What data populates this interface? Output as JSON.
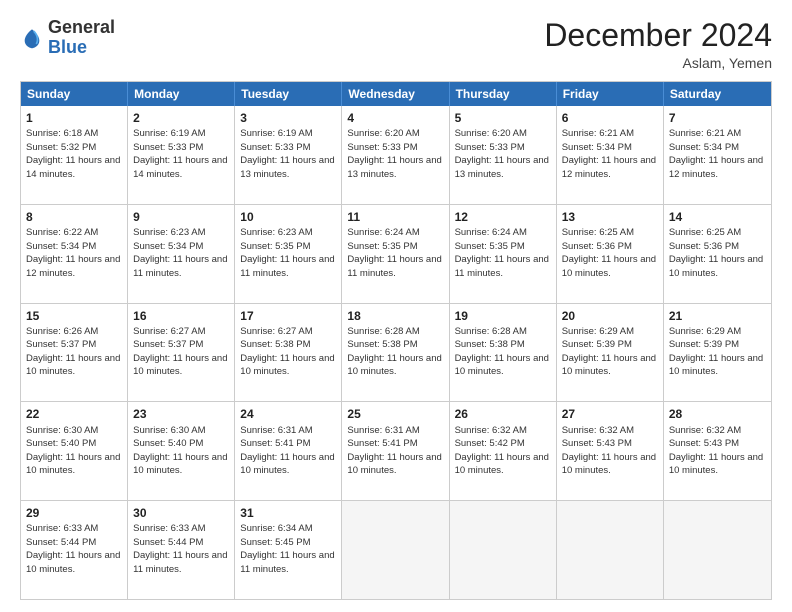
{
  "header": {
    "logo_general": "General",
    "logo_blue": "Blue",
    "month_title": "December 2024",
    "location": "Aslam, Yemen"
  },
  "weekdays": [
    "Sunday",
    "Monday",
    "Tuesday",
    "Wednesday",
    "Thursday",
    "Friday",
    "Saturday"
  ],
  "rows": [
    [
      {
        "day": "1",
        "sunrise": "6:18 AM",
        "sunset": "5:32 PM",
        "daylight": "11 hours and 14 minutes."
      },
      {
        "day": "2",
        "sunrise": "6:19 AM",
        "sunset": "5:33 PM",
        "daylight": "11 hours and 14 minutes."
      },
      {
        "day": "3",
        "sunrise": "6:19 AM",
        "sunset": "5:33 PM",
        "daylight": "11 hours and 13 minutes."
      },
      {
        "day": "4",
        "sunrise": "6:20 AM",
        "sunset": "5:33 PM",
        "daylight": "11 hours and 13 minutes."
      },
      {
        "day": "5",
        "sunrise": "6:20 AM",
        "sunset": "5:33 PM",
        "daylight": "11 hours and 13 minutes."
      },
      {
        "day": "6",
        "sunrise": "6:21 AM",
        "sunset": "5:34 PM",
        "daylight": "11 hours and 12 minutes."
      },
      {
        "day": "7",
        "sunrise": "6:21 AM",
        "sunset": "5:34 PM",
        "daylight": "11 hours and 12 minutes."
      }
    ],
    [
      {
        "day": "8",
        "sunrise": "6:22 AM",
        "sunset": "5:34 PM",
        "daylight": "11 hours and 12 minutes."
      },
      {
        "day": "9",
        "sunrise": "6:23 AM",
        "sunset": "5:34 PM",
        "daylight": "11 hours and 11 minutes."
      },
      {
        "day": "10",
        "sunrise": "6:23 AM",
        "sunset": "5:35 PM",
        "daylight": "11 hours and 11 minutes."
      },
      {
        "day": "11",
        "sunrise": "6:24 AM",
        "sunset": "5:35 PM",
        "daylight": "11 hours and 11 minutes."
      },
      {
        "day": "12",
        "sunrise": "6:24 AM",
        "sunset": "5:35 PM",
        "daylight": "11 hours and 11 minutes."
      },
      {
        "day": "13",
        "sunrise": "6:25 AM",
        "sunset": "5:36 PM",
        "daylight": "11 hours and 10 minutes."
      },
      {
        "day": "14",
        "sunrise": "6:25 AM",
        "sunset": "5:36 PM",
        "daylight": "11 hours and 10 minutes."
      }
    ],
    [
      {
        "day": "15",
        "sunrise": "6:26 AM",
        "sunset": "5:37 PM",
        "daylight": "11 hours and 10 minutes."
      },
      {
        "day": "16",
        "sunrise": "6:27 AM",
        "sunset": "5:37 PM",
        "daylight": "11 hours and 10 minutes."
      },
      {
        "day": "17",
        "sunrise": "6:27 AM",
        "sunset": "5:38 PM",
        "daylight": "11 hours and 10 minutes."
      },
      {
        "day": "18",
        "sunrise": "6:28 AM",
        "sunset": "5:38 PM",
        "daylight": "11 hours and 10 minutes."
      },
      {
        "day": "19",
        "sunrise": "6:28 AM",
        "sunset": "5:38 PM",
        "daylight": "11 hours and 10 minutes."
      },
      {
        "day": "20",
        "sunrise": "6:29 AM",
        "sunset": "5:39 PM",
        "daylight": "11 hours and 10 minutes."
      },
      {
        "day": "21",
        "sunrise": "6:29 AM",
        "sunset": "5:39 PM",
        "daylight": "11 hours and 10 minutes."
      }
    ],
    [
      {
        "day": "22",
        "sunrise": "6:30 AM",
        "sunset": "5:40 PM",
        "daylight": "11 hours and 10 minutes."
      },
      {
        "day": "23",
        "sunrise": "6:30 AM",
        "sunset": "5:40 PM",
        "daylight": "11 hours and 10 minutes."
      },
      {
        "day": "24",
        "sunrise": "6:31 AM",
        "sunset": "5:41 PM",
        "daylight": "11 hours and 10 minutes."
      },
      {
        "day": "25",
        "sunrise": "6:31 AM",
        "sunset": "5:41 PM",
        "daylight": "11 hours and 10 minutes."
      },
      {
        "day": "26",
        "sunrise": "6:32 AM",
        "sunset": "5:42 PM",
        "daylight": "11 hours and 10 minutes."
      },
      {
        "day": "27",
        "sunrise": "6:32 AM",
        "sunset": "5:43 PM",
        "daylight": "11 hours and 10 minutes."
      },
      {
        "day": "28",
        "sunrise": "6:32 AM",
        "sunset": "5:43 PM",
        "daylight": "11 hours and 10 minutes."
      }
    ],
    [
      {
        "day": "29",
        "sunrise": "6:33 AM",
        "sunset": "5:44 PM",
        "daylight": "11 hours and 10 minutes."
      },
      {
        "day": "30",
        "sunrise": "6:33 AM",
        "sunset": "5:44 PM",
        "daylight": "11 hours and 11 minutes."
      },
      {
        "day": "31",
        "sunrise": "6:34 AM",
        "sunset": "5:45 PM",
        "daylight": "11 hours and 11 minutes."
      },
      null,
      null,
      null,
      null
    ]
  ]
}
